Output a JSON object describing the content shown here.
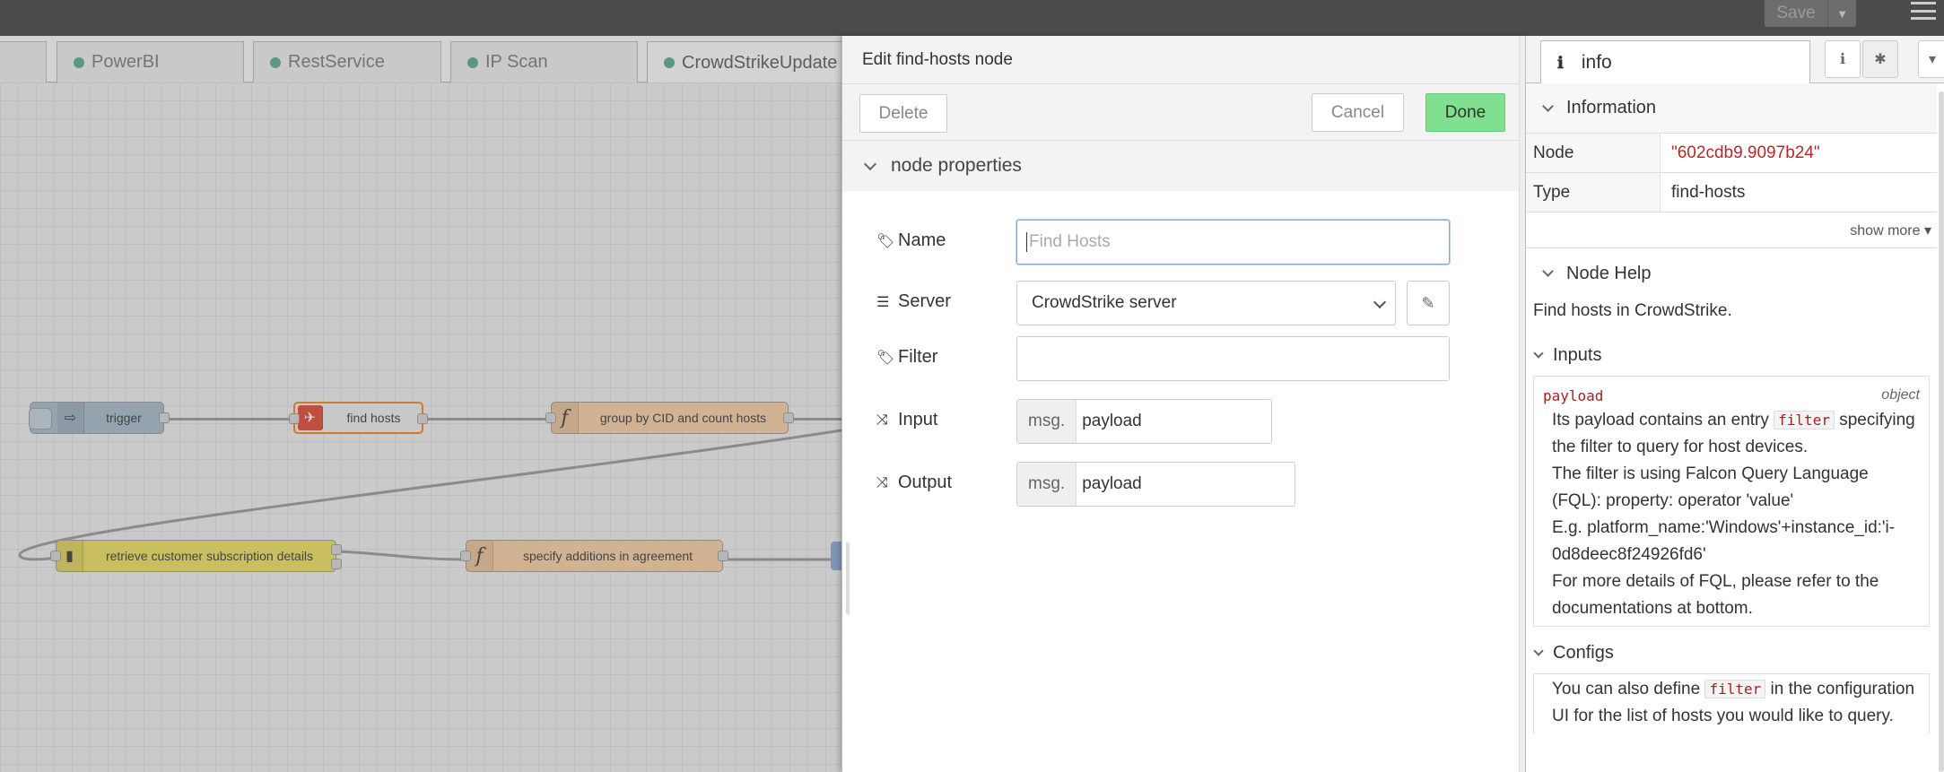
{
  "header": {
    "save_label": "Save"
  },
  "workspace": {
    "tabs": [
      {
        "label": "PowerBI"
      },
      {
        "label": "RestService"
      },
      {
        "label": "IP Scan"
      },
      {
        "label": "CrowdStrikeUpdate"
      }
    ],
    "nodes": {
      "trigger": "trigger",
      "find_hosts": "find hosts",
      "group": "group by CID and count hosts",
      "retrieve": "retrieve customer subscription details",
      "specify": "specify additions in agreement"
    }
  },
  "editor": {
    "title": "Edit find-hosts node",
    "delete_label": "Delete",
    "cancel_label": "Cancel",
    "done_label": "Done",
    "section_label": "node properties",
    "name_label": "Name",
    "name_placeholder": "Find Hosts",
    "server_label": "Server",
    "server_value": "CrowdStrike server",
    "filter_label": "Filter",
    "filter_value": "",
    "input_label": "Input",
    "input_prefix": "msg.",
    "input_value": "payload",
    "output_label": "Output",
    "output_prefix": "msg.",
    "output_value": "payload"
  },
  "sidebar": {
    "tab_label": "info",
    "information_header": "Information",
    "node_key": "Node",
    "node_value": "\"602cdb9.9097b24\"",
    "type_key": "Type",
    "type_value": "find-hosts",
    "show_more": "show more ▾",
    "help_header": "Node Help",
    "help_intro": "Find hosts in CrowdStrike.",
    "inputs_header": "Inputs",
    "prop_name": "payload",
    "prop_type": "object",
    "doc1_a": "Its payload contains an entry",
    "doc1_code": "filter",
    "doc1_b": "specifying the filter to query for host devices.",
    "doc2": "The filter is using Falcon Query Language (FQL): property: operator 'value'",
    "doc3": "E.g. platform_name:'Windows'+instance_id:'i-0d8deec8f24926fd6'",
    "doc4": "For more details of FQL, please refer to the documentations at bottom.",
    "configs_header": "Configs",
    "cfg_a": "You can also define",
    "cfg_code": "filter",
    "cfg_b": "in the configuration UI for the list of hosts you would like to query."
  }
}
